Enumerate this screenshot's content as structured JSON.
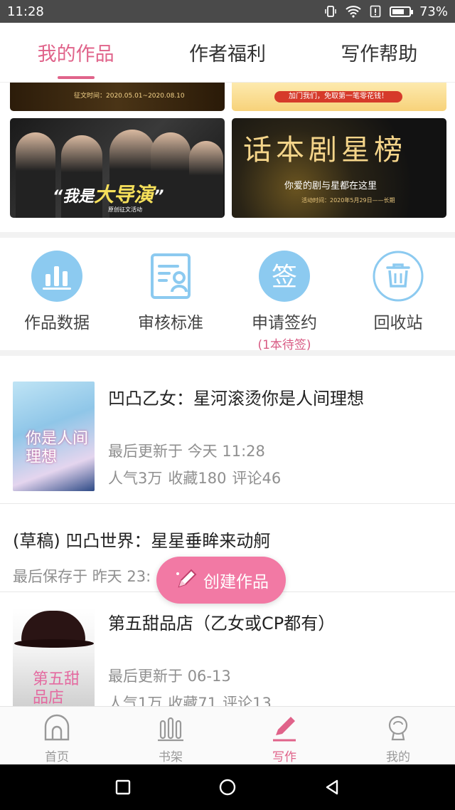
{
  "status_bar": {
    "time": "11:28",
    "battery": "73%",
    "battery_level": 0.73
  },
  "top_tabs": [
    {
      "label": "我的作品",
      "active": true
    },
    {
      "label": "作者福利",
      "active": false
    },
    {
      "label": "写作帮助",
      "active": false
    }
  ],
  "banners": {
    "contest_date": "征文时间：2020.05.01~2020.08.10",
    "join_ribbon": "加门我们，免取第一笔零花钱！",
    "director_title_pre": "“我是",
    "director_title_big": "大导演",
    "director_title_post": "”",
    "director_sub": "原创征文活动",
    "drama_title": "话本剧星榜",
    "drama_sub": "你爱的剧与星都在这里",
    "drama_date": "活动时间：2020年5月29日——长期"
  },
  "actions": [
    {
      "label": "作品数据",
      "icon": "chart-icon"
    },
    {
      "label": "审核标准",
      "icon": "review-doc-icon"
    },
    {
      "label": "申请签约",
      "icon": "sign-icon",
      "icon_char": "签",
      "sub": "(1本待签)"
    },
    {
      "label": "回收站",
      "icon": "trash-icon"
    }
  ],
  "works": [
    {
      "title": "凹凸乙女：星河滚烫你是人间理想",
      "cover_text": "你是人间理想",
      "updated_label": "最后更新于",
      "updated": "今天 11:28",
      "popularity": "人气3万",
      "favorites": "收藏180",
      "comments": "评论46"
    },
    {
      "title": "(草稿) 凹凸世界：星星垂眸来动舸",
      "saved_label": "最后保存于",
      "saved": "昨天 23:"
    },
    {
      "title": "第五甜品店（乙女或CP都有）",
      "cover_text": "第五甜品店",
      "updated_label": "最后更新于",
      "updated": "06-13",
      "popularity": "人气1万",
      "favorites": "收藏71",
      "comments": "评论13"
    }
  ],
  "fab": {
    "label": "创建作品",
    "icon": "pencil-icon"
  },
  "bottom_nav": [
    {
      "label": "首页",
      "icon": "home-icon",
      "active": false
    },
    {
      "label": "书架",
      "icon": "bookshelf-icon",
      "active": false
    },
    {
      "label": "写作",
      "icon": "pencil-icon",
      "active": true
    },
    {
      "label": "我的",
      "icon": "profile-icon",
      "active": false
    }
  ],
  "colors": {
    "accent": "#e0638a",
    "fab": "#f279a4",
    "icon_blue": "#8ccaf0"
  }
}
